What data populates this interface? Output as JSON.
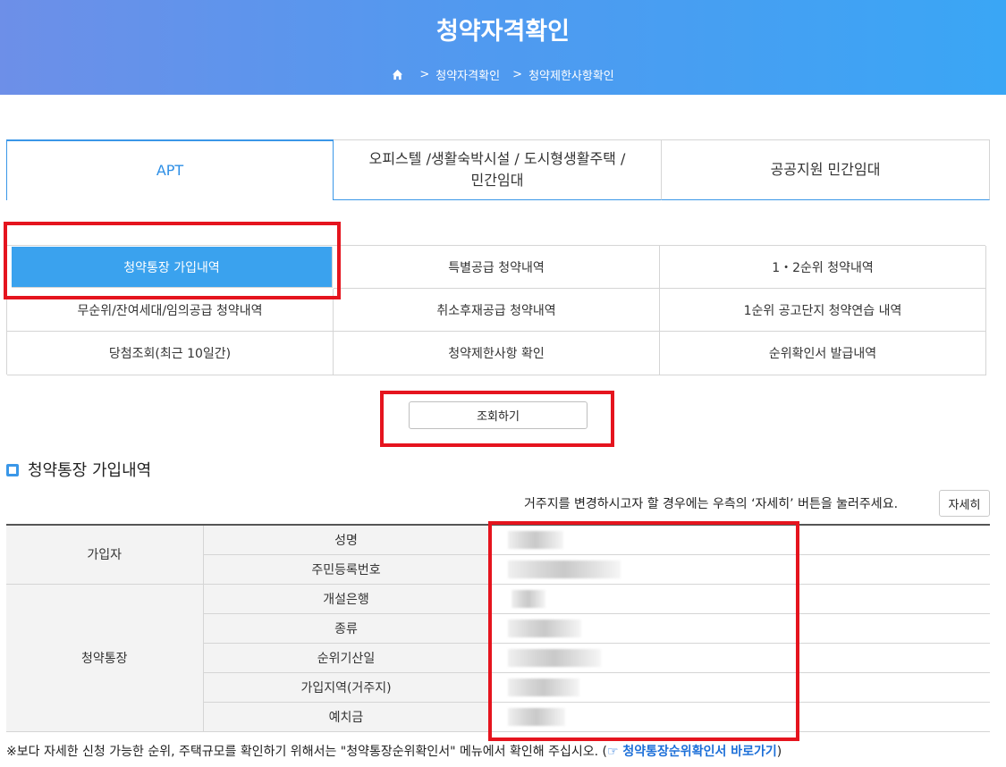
{
  "header": {
    "title": "청약자격확인",
    "breadcrumb": [
      "청약자격확인",
      "청약제한사항확인"
    ]
  },
  "tabs": [
    {
      "label": "APT",
      "active": true
    },
    {
      "label": "오피스텔 /생활숙박시설 / 도시형생활주택 /\n민간임대",
      "active": false
    },
    {
      "label": "공공지원 민간임대",
      "active": false
    }
  ],
  "subtabs": [
    "청약통장 가입내역",
    "특별공급 청약내역",
    "1・2순위 청약내역",
    "무순위/잔여세대/임의공급 청약내역",
    "취소후재공급 청약내역",
    "1순위 공고단지 청약연습 내역",
    "당첨조회(최근 10일간)",
    "청약제한사항 확인",
    "순위확인서 발급내역"
  ],
  "selected_subtab": "청약통장 가입내역",
  "search_button": "조회하기",
  "section_title": "청약통장 가입내역",
  "notice": "거주지를 변경하시고자 할 경우에는 우측의 ‘자세히’ 버튼을 눌러주세요.",
  "detail_button": "자세히",
  "table": {
    "groups": [
      "가입자",
      "청약통장"
    ],
    "fields": [
      "성명",
      "주민등록번호",
      "개설은행",
      "종류",
      "순위기산일",
      "가입지역(거주지)",
      "예치금"
    ]
  },
  "footnote": {
    "text": "※보다 자세한 신청 가능한 순위, 주택규모를 확인하기 위해서는 \"청약통장순위확인서\" 메뉴에서 확인해 주십시오. (",
    "link": "☞ 청약통장순위확인서 바로가기",
    "close": ")"
  },
  "colors": {
    "accent": "#3a97e8",
    "highlight": "#e5141e",
    "selected_bg": "#3aa2ee"
  }
}
